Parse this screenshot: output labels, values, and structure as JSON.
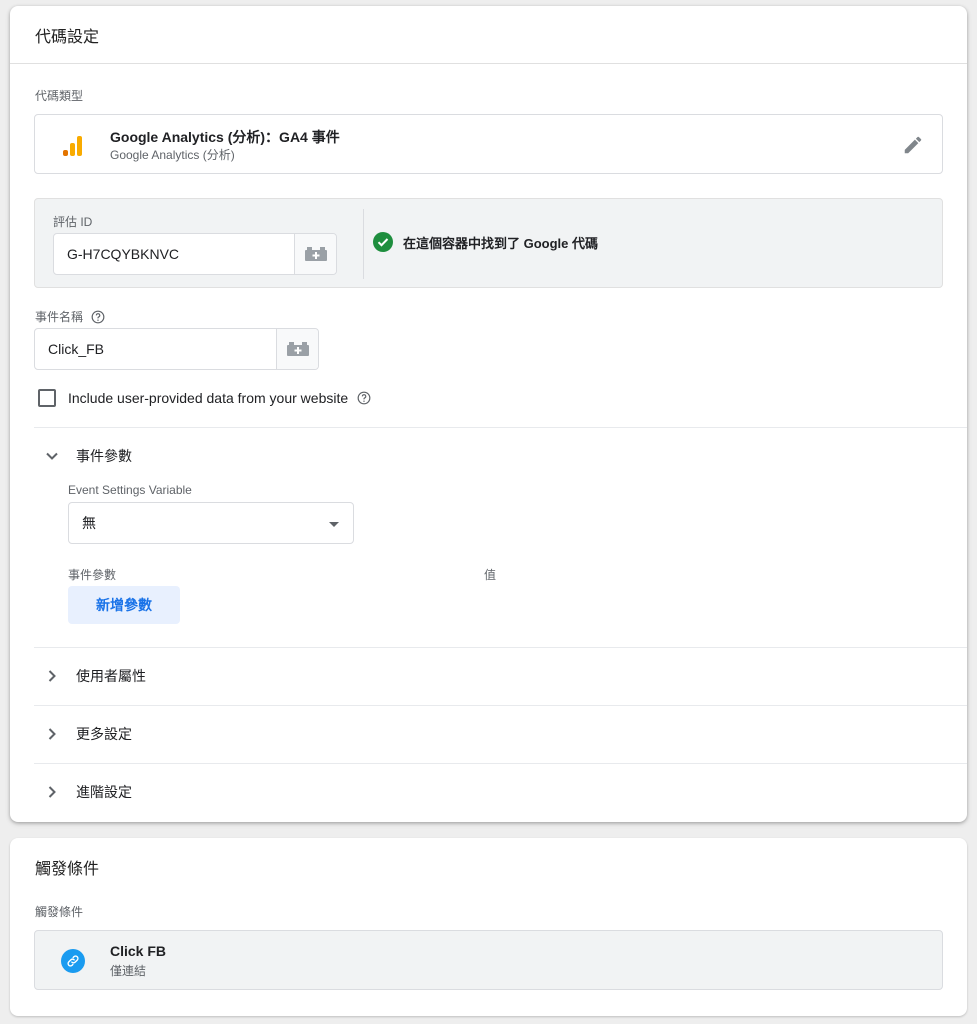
{
  "tag_config": {
    "header": "代碼設定",
    "tag_type_label": "代碼類型",
    "tag_type": {
      "title": "Google Analytics (分析)：GA4 事件",
      "subtitle": "Google Analytics (分析)",
      "icon": "google-analytics-icon",
      "logo_colors": [
        "#e37400",
        "#f9ab00",
        "#f9ab00"
      ]
    },
    "measurement": {
      "label": "評估 ID",
      "value": "G-H7CQYBKNVC",
      "status_text": "在這個容器中找到了 Google 代碼",
      "status_color": "#1e8e3e"
    },
    "event_name": {
      "label": "事件名稱",
      "value": "Click_FB"
    },
    "user_data_checkbox": {
      "label": "Include user-provided data from your website",
      "checked": false
    },
    "event_params": {
      "title": "事件參數",
      "expanded": true,
      "settings_variable_label": "Event Settings Variable",
      "settings_variable_value": "無",
      "param_col_label": "事件參數",
      "value_col_label": "值",
      "add_button": "新增參數",
      "add_button_color": "#1a73e8"
    },
    "collapsed_sections": [
      {
        "title": "使用者屬性"
      },
      {
        "title": "更多設定"
      },
      {
        "title": "進階設定"
      }
    ]
  },
  "triggering": {
    "header": "觸發條件",
    "label": "觸發條件",
    "trigger": {
      "title": "Click FB",
      "subtitle": "僅連結",
      "icon": "link-icon",
      "icon_color": "#1a9bf0"
    }
  }
}
